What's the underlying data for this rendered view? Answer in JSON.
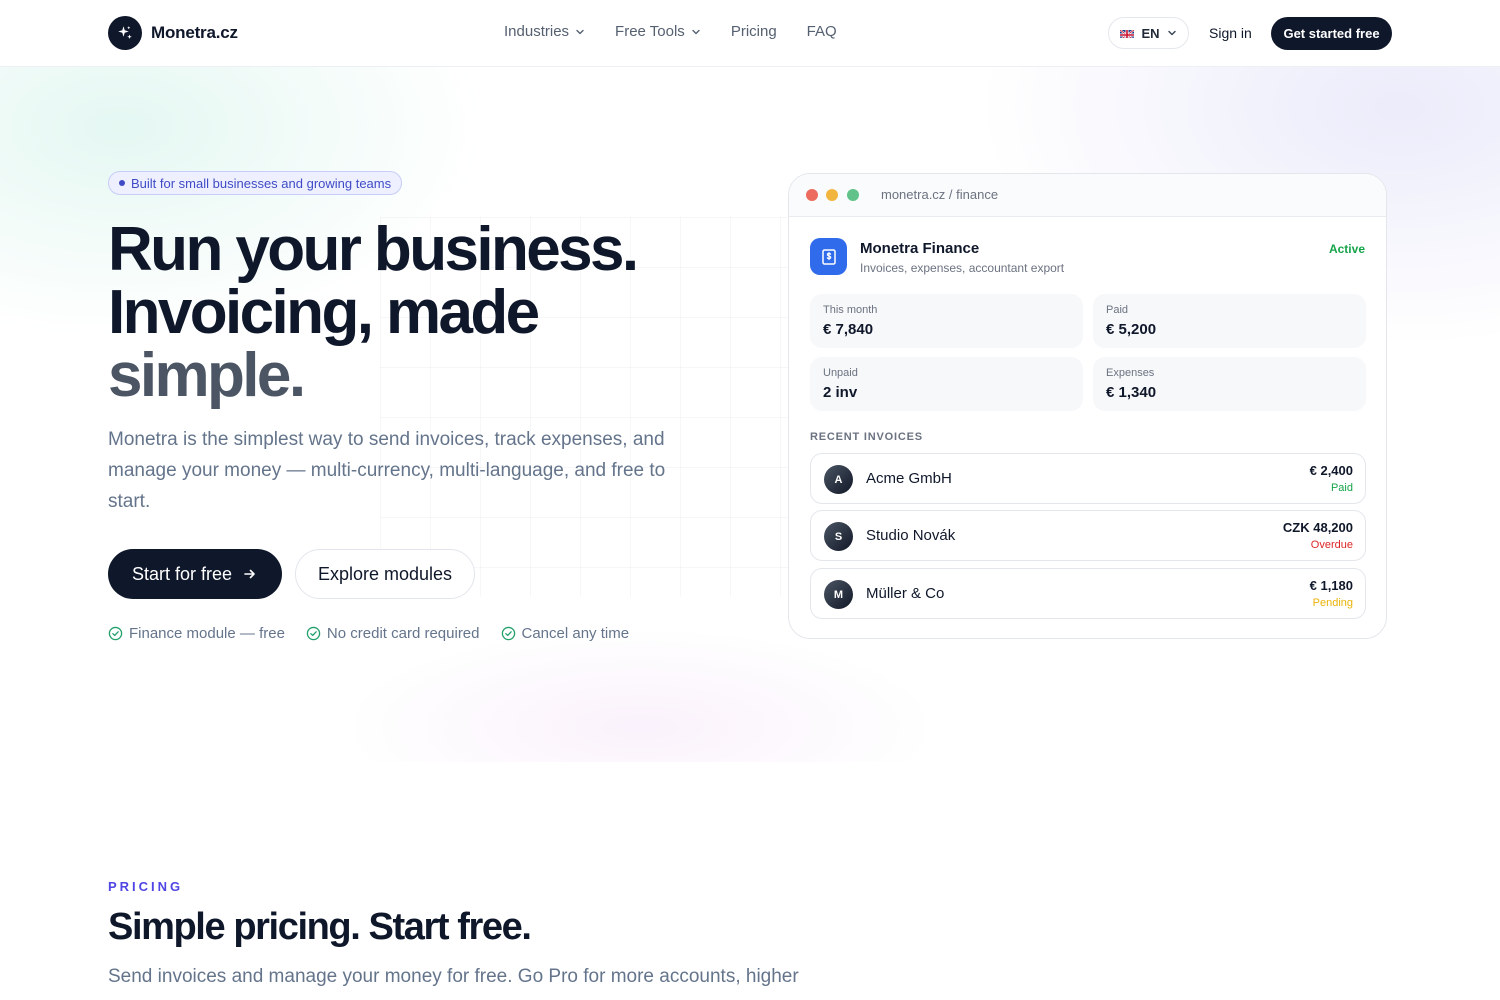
{
  "header": {
    "brand": "Monetra.cz",
    "nav": [
      {
        "label": "Industries",
        "dropdown": true
      },
      {
        "label": "Free Tools",
        "dropdown": true
      },
      {
        "label": "Pricing",
        "dropdown": false
      },
      {
        "label": "FAQ",
        "dropdown": false
      }
    ],
    "language": "EN",
    "sign_in": "Sign in",
    "cta": "Get started free"
  },
  "hero": {
    "badge": "Built for small businesses and growing teams",
    "headline_line1": "Run your business.",
    "headline_line2": "Invoicing, made",
    "headline_line3": "simple.",
    "lead": "Monetra is the simplest way to send invoices, track expenses, and manage your money — multi-currency, multi-language, and free to start.",
    "primary_button": "Start for free",
    "secondary_button": "Explore modules",
    "checks": [
      "Finance module — free",
      "No credit card required",
      "Cancel any time"
    ]
  },
  "mockup": {
    "url": "monetra.cz / finance",
    "app_title": "Monetra Finance",
    "app_subtitle": "Invoices, expenses, accountant export",
    "status": "Active",
    "stats": [
      {
        "label": "This month",
        "value": "€ 7,840"
      },
      {
        "label": "Paid",
        "value": "€ 5,200"
      },
      {
        "label": "Unpaid",
        "value": "2 inv"
      },
      {
        "label": "Expenses",
        "value": "€ 1,340"
      }
    ],
    "recent_label": "RECENT INVOICES",
    "invoices": [
      {
        "initial": "A",
        "name": "Acme GmbH",
        "amount": "€ 2,400",
        "status": "Paid",
        "status_color": "#16a34a"
      },
      {
        "initial": "S",
        "name": "Studio Novák",
        "amount": "CZK 48,200",
        "status": "Overdue",
        "status_color": "#dc2626"
      },
      {
        "initial": "M",
        "name": "Müller & Co",
        "amount": "€ 1,180",
        "status": "Pending",
        "status_color": "#eab308"
      }
    ]
  },
  "pricing": {
    "eyebrow": "PRICING",
    "title": "Simple pricing. Start free.",
    "lead": "Send invoices and manage your money for free. Go Pro for more accounts, higher"
  },
  "colors": {
    "primary": "#0f172a",
    "accent": "#4f46e5",
    "app_icon": "#2f6bea"
  },
  "icons": {
    "logo": "sparkle-icon",
    "dropdown": "chevron-down-icon",
    "arrow": "arrow-right-icon",
    "check": "check-circle-icon",
    "flag": "uk-flag-icon",
    "app": "dollar-document-icon"
  }
}
